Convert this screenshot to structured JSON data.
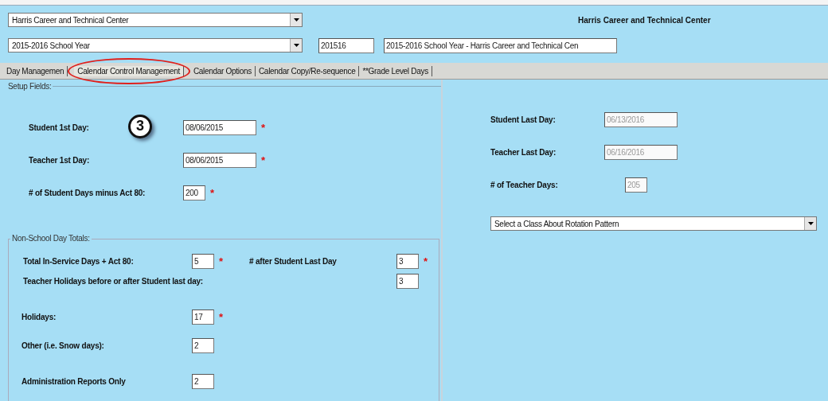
{
  "school_select": {
    "value": "Harris Career and Technical Center"
  },
  "header_title": "Harris Career and Technical Center",
  "required_mark": "*",
  "year_select": {
    "value": "2015-2016 School Year"
  },
  "year_code": {
    "value": "201516"
  },
  "year_description": {
    "value": "2015-2016 School Year - Harris Career and Technical Cen"
  },
  "tabs": [
    {
      "label": "Day Managemen",
      "selected": false,
      "highlighted": false
    },
    {
      "label": "Calendar Control Management",
      "selected": true,
      "highlighted": true
    },
    {
      "label": "Calendar Options",
      "selected": false,
      "highlighted": false
    },
    {
      "label": "Calendar Copy/Re-sequence",
      "selected": false,
      "highlighted": false
    },
    {
      "label": "**Grade Level Days",
      "selected": false,
      "highlighted": false
    }
  ],
  "setup_fields": {
    "legend": "Setup Fields:",
    "step_badge": "3",
    "left": [
      {
        "label": "Student 1st Day:",
        "value": "08/06/2015",
        "kind": "date",
        "required": true,
        "disabled": false
      },
      {
        "label": "Teacher 1st Day:",
        "value": "08/06/2015",
        "kind": "date",
        "required": true,
        "disabled": false
      },
      {
        "label": "# of Student Days minus Act 80:",
        "value": "200",
        "kind": "number",
        "required": true,
        "disabled": false
      }
    ],
    "right": [
      {
        "label": "Student Last Day:",
        "value": "06/13/2016",
        "kind": "date",
        "required": false,
        "disabled": true
      },
      {
        "label": "Teacher Last Day:",
        "value": "06/16/2016",
        "kind": "date",
        "required": false,
        "disabled": true
      },
      {
        "label": "# of Teacher Days:",
        "value": "205",
        "kind": "number",
        "required": false,
        "disabled": true
      }
    ]
  },
  "rotation_select": {
    "value": "Select a Class About Rotation Pattern"
  },
  "non_school": {
    "legend": "Non-School Day Totals:",
    "rows": [
      {
        "kind": "pair",
        "fields": [
          {
            "label": "Total In-Service Days + Act 80:",
            "value": "5",
            "required": true
          },
          {
            "label": "# after Student Last Day",
            "value": "3",
            "required": true
          }
        ]
      },
      {
        "kind": "wide",
        "fields": [
          {
            "label": "Teacher Holidays before or after Student last day:",
            "value": "3",
            "required": false
          }
        ]
      },
      {
        "kind": "pair",
        "fields": [
          {
            "label": "Holidays:",
            "value": "17",
            "required": true
          }
        ]
      },
      {
        "kind": "pair",
        "fields": [
          {
            "label": "Other (i.e. Snow days):",
            "value": "2",
            "required": false
          }
        ]
      },
      {
        "kind": "pair",
        "fields": [
          {
            "label": "Administration Reports Only",
            "value": "2",
            "required": false
          }
        ]
      }
    ]
  }
}
